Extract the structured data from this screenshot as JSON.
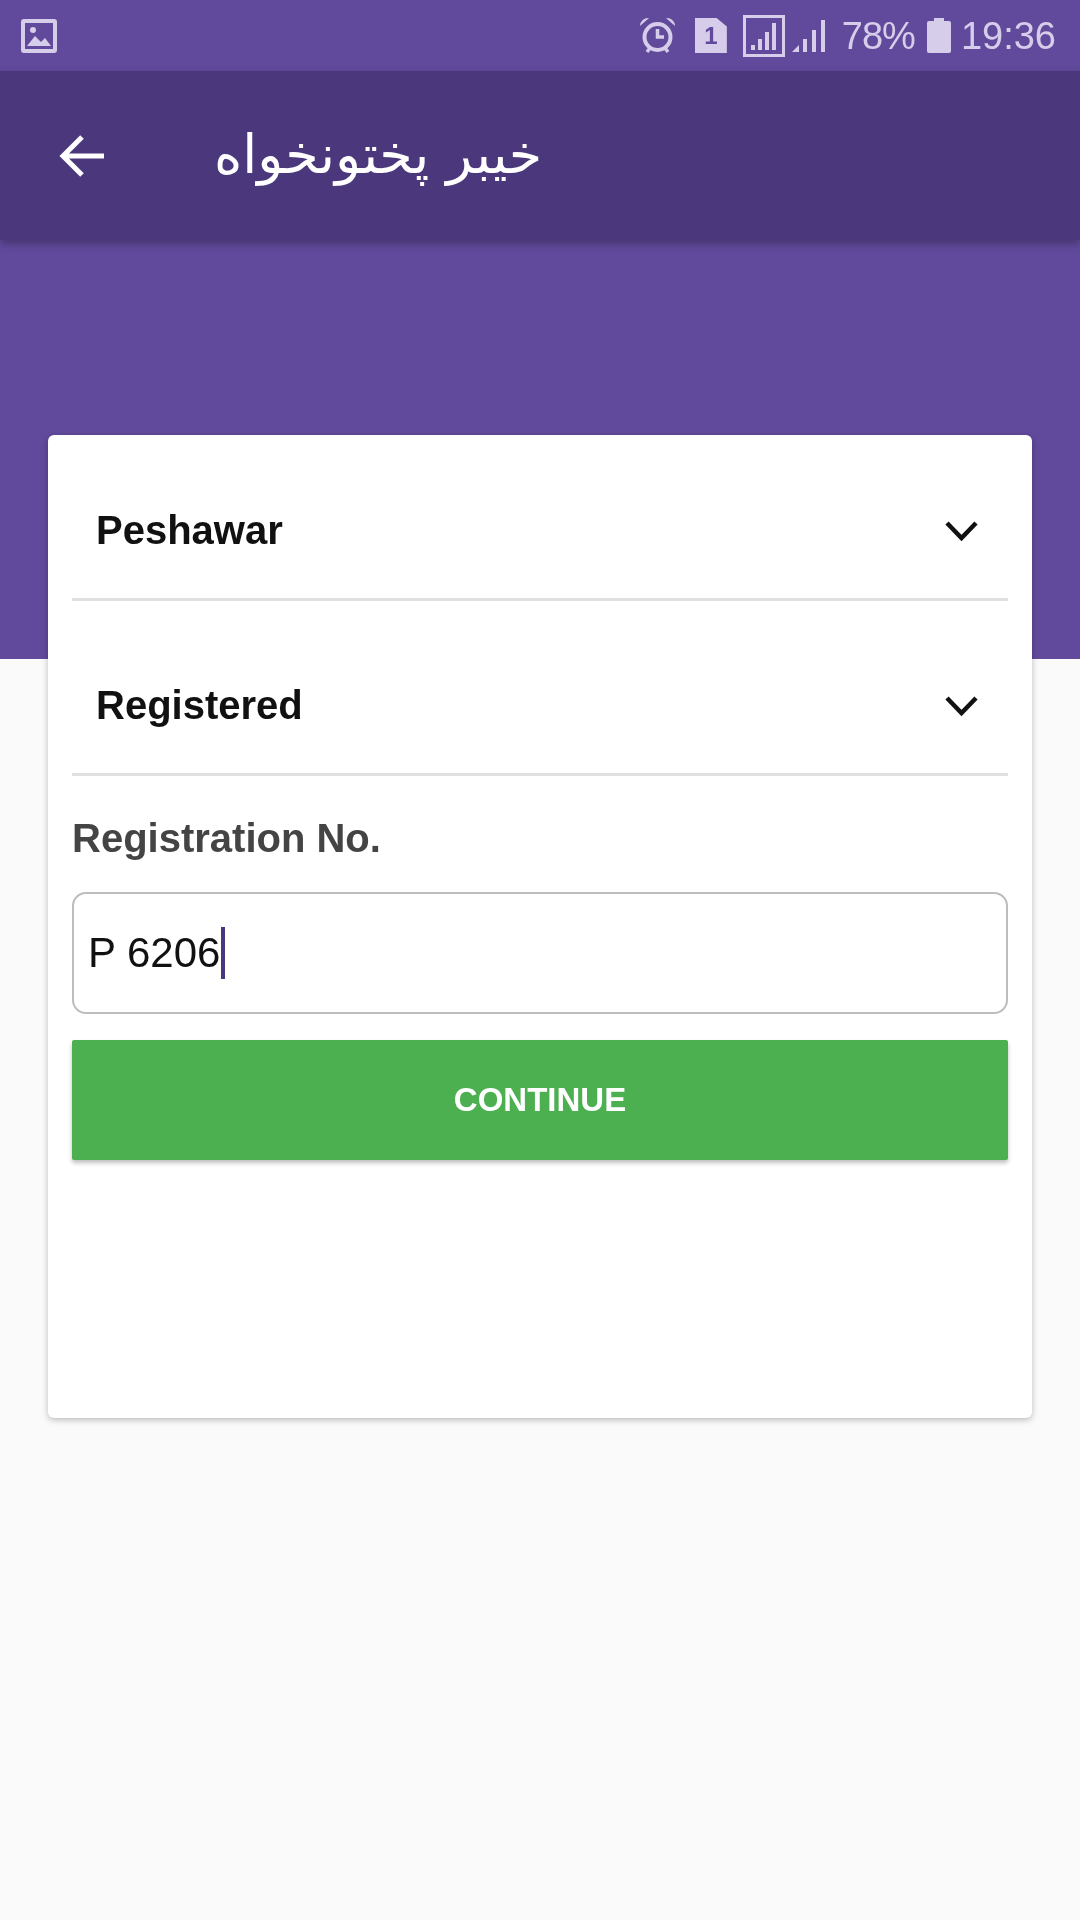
{
  "status_bar": {
    "sim": "1",
    "battery_percent": "78%",
    "time": "19:36"
  },
  "app_bar": {
    "title": "خیبر پختونخواه"
  },
  "form": {
    "dropdowns": [
      {
        "value": "Peshawar"
      },
      {
        "value": "Registered"
      }
    ],
    "field": {
      "label": "Registration No.",
      "value": "P 6206",
      "focused": true
    },
    "button": "CONTINUE"
  }
}
